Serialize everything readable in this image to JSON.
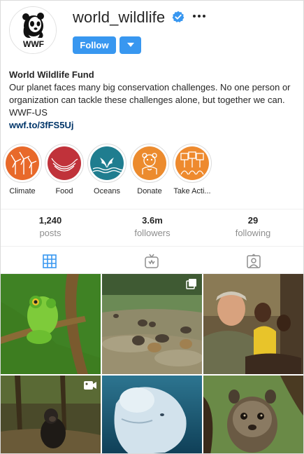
{
  "profile": {
    "username": "world_wildlife",
    "logo_text": "WWF",
    "follow_label": "Follow",
    "name": "World Wildlife Fund",
    "bio": "Our planet faces many big conservation challenges. No one person or organization can tackle these challenges alone, but together we can. WWF-US",
    "link": "wwf.to/3fFS5Uj"
  },
  "highlights": [
    {
      "label": "Climate",
      "icon": "wind-turbine-icon",
      "color": "#e8692a"
    },
    {
      "label": "Food",
      "icon": "bananas-icon",
      "color": "#c0323a"
    },
    {
      "label": "Oceans",
      "icon": "whale-tail-icon",
      "color": "#1f7d8f"
    },
    {
      "label": "Donate",
      "icon": "panda-heart-icon",
      "color": "#ec8b2e"
    },
    {
      "label": "Take Acti...",
      "icon": "protest-signs-icon",
      "color": "#ee8a2e"
    }
  ],
  "stats": [
    {
      "value": "1,240",
      "label": "posts"
    },
    {
      "value": "3.6m",
      "label": "followers"
    },
    {
      "value": "29",
      "label": "following"
    }
  ],
  "tabs": [
    {
      "name": "posts-grid",
      "icon": "grid-icon",
      "active": true
    },
    {
      "name": "igtv",
      "icon": "tv-icon",
      "active": false
    },
    {
      "name": "tagged",
      "icon": "tagged-person-icon",
      "active": false
    }
  ],
  "posts": [
    {
      "subject": "frog",
      "badge": null
    },
    {
      "subject": "elephants",
      "badge": "multiple-posts-icon"
    },
    {
      "subject": "people-smiling",
      "badge": null
    },
    {
      "subject": "chimpanzee",
      "badge": "video-icon"
    },
    {
      "subject": "beluga-whale",
      "badge": null
    },
    {
      "subject": "binturong",
      "badge": null
    }
  ],
  "colors": {
    "accent": "#3897f0",
    "link": "#003569",
    "verified": "#3897f0",
    "muted": "#8e8e8e"
  }
}
